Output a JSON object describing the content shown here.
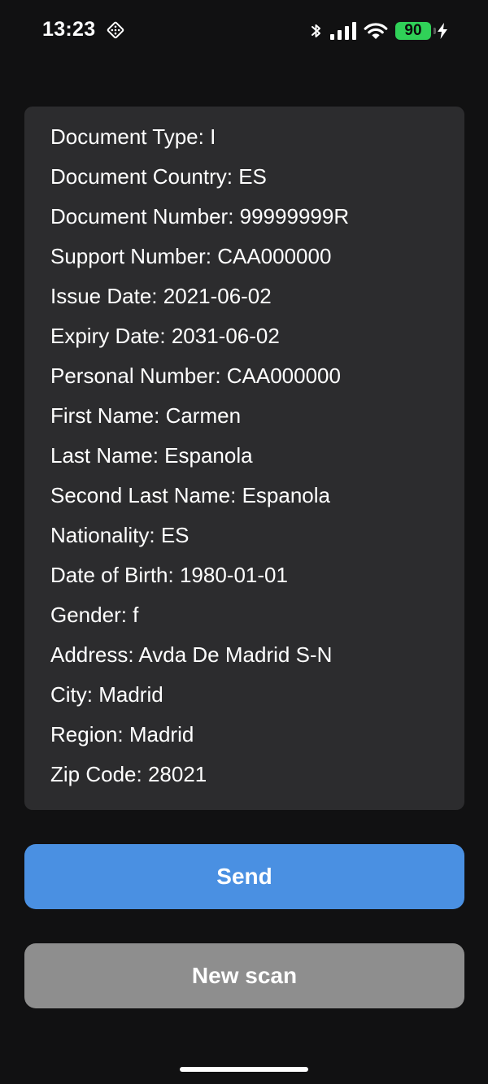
{
  "status_bar": {
    "time": "13:23",
    "battery_level": "90",
    "colors": {
      "battery": "#30d158",
      "icons": "#ffffff"
    }
  },
  "document_info": {
    "rows": [
      "Document Type: I",
      "Document Country: ES",
      "Document Number: 99999999R",
      "Support Number: CAA000000",
      "Issue Date: 2021-06-02",
      "Expiry Date: 2031-06-02",
      "Personal Number: CAA000000",
      "First Name: Carmen",
      "Last Name: Espanola",
      "Second Last Name: Espanola",
      "Nationality: ES",
      "Date of Birth: 1980-01-01",
      "Gender: f",
      "Address: Avda De Madrid S-N",
      "City: Madrid",
      "Region: Madrid",
      "Zip Code: 28021"
    ]
  },
  "actions": {
    "send_label": "Send",
    "new_scan_label": "New scan",
    "colors": {
      "send": "#4a90e2",
      "new_scan": "#8e8e8e"
    }
  },
  "theme": {
    "background": "#111112",
    "card": "#2c2c2e",
    "text": "#ffffff"
  },
  "icons": {
    "status_left": "location-diamond-icon",
    "bluetooth": "bluetooth-icon",
    "signal": "cellular-signal-icon",
    "wifi": "wifi-icon",
    "charging": "charging-bolt-icon"
  }
}
